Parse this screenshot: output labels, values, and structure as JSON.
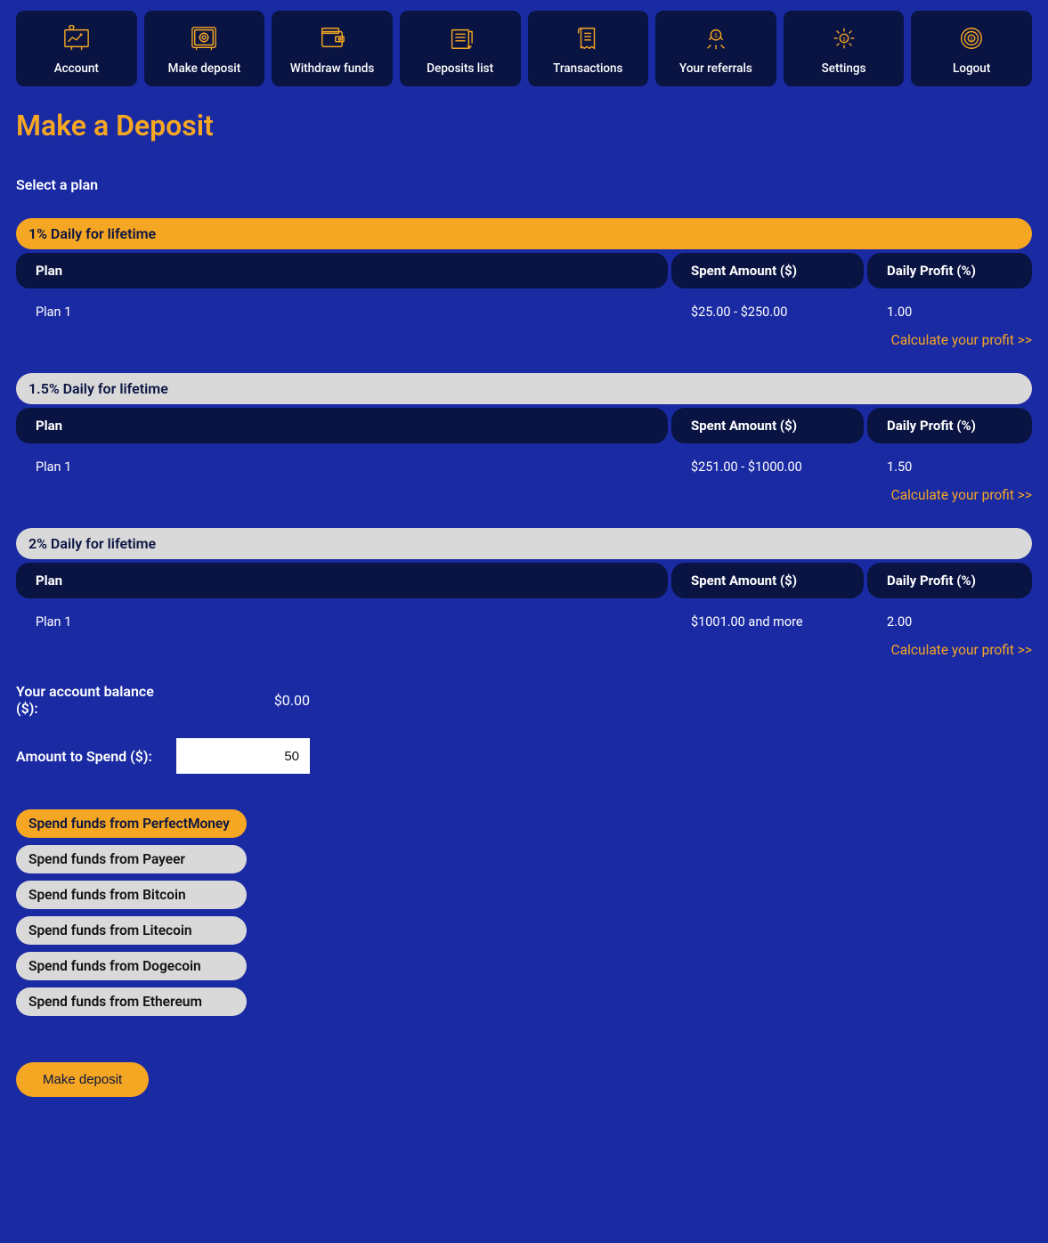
{
  "nav": {
    "items": [
      {
        "label": "Account"
      },
      {
        "label": "Make deposit"
      },
      {
        "label": "Withdraw funds"
      },
      {
        "label": "Deposits list"
      },
      {
        "label": "Transactions"
      },
      {
        "label": "Your referrals"
      },
      {
        "label": "Settings"
      },
      {
        "label": "Logout"
      }
    ]
  },
  "page": {
    "title": "Make a Deposit"
  },
  "select_plan_label": "Select a plan",
  "plans": [
    {
      "title": "1% Daily for lifetime",
      "active": true,
      "columns": {
        "plan": "Plan",
        "spent": "Spent Amount ($)",
        "profit": "Daily Profit (%)"
      },
      "row": {
        "name": "Plan 1",
        "spent": "$25.00 - $250.00",
        "profit": "1.00"
      },
      "calc": "Calculate your profit >>"
    },
    {
      "title": "1.5% Daily for lifetime",
      "active": false,
      "columns": {
        "plan": "Plan",
        "spent": "Spent Amount ($)",
        "profit": "Daily Profit (%)"
      },
      "row": {
        "name": "Plan 1",
        "spent": "$251.00 - $1000.00",
        "profit": "1.50"
      },
      "calc": "Calculate your profit >>"
    },
    {
      "title": "2% Daily for lifetime",
      "active": false,
      "columns": {
        "plan": "Plan",
        "spent": "Spent Amount ($)",
        "profit": "Daily Profit (%)"
      },
      "row": {
        "name": "Plan 1",
        "spent": "$1001.00 and more",
        "profit": "2.00"
      },
      "calc": "Calculate your profit >>"
    }
  ],
  "balance": {
    "label": "Your account balance ($):",
    "value": "$0.00"
  },
  "amount": {
    "label": "Amount to Spend ($):",
    "value": "50"
  },
  "payments": [
    {
      "label": "Spend funds from PerfectMoney",
      "selected": true
    },
    {
      "label": "Spend funds from Payeer",
      "selected": false
    },
    {
      "label": "Spend funds from Bitcoin",
      "selected": false
    },
    {
      "label": "Spend funds from Litecoin",
      "selected": false
    },
    {
      "label": "Spend funds from Dogecoin",
      "selected": false
    },
    {
      "label": "Spend funds from Ethereum",
      "selected": false
    }
  ],
  "submit": {
    "label": "Make deposit"
  }
}
